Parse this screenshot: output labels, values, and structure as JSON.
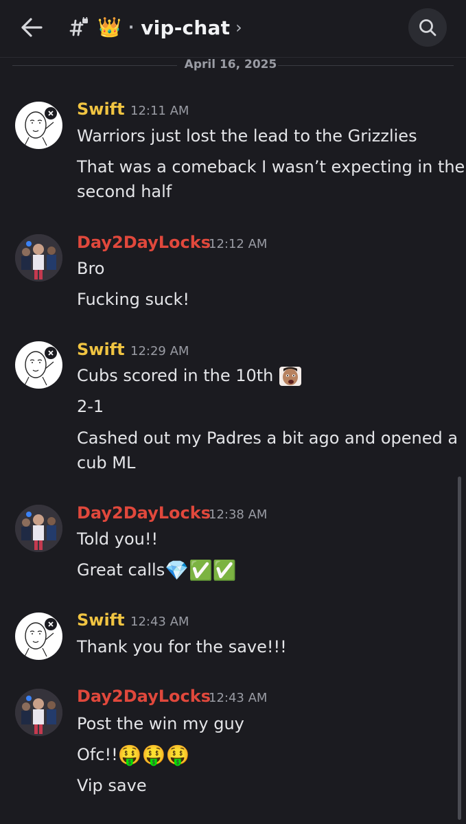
{
  "header": {
    "back_icon": "arrow-left-icon",
    "channel_icon": "hash-lock-icon",
    "channel_emoji": "👑",
    "separator": "·",
    "channel_name": "vip-chat",
    "chevron": "›",
    "search_icon": "search-icon"
  },
  "date_divider": "April 16, 2025",
  "colors": {
    "swift": "#f0c442",
    "d2d": "#e0483c",
    "background": "#1b1b20"
  },
  "messages": [
    {
      "user": "Swift",
      "time": "12:11 AM",
      "lines": [
        "Warriors just lost the lead to the Grizzlies",
        "That was a comeback I wasn’t expecting in the",
        "second half"
      ]
    },
    {
      "user": "Day2DayLocks",
      "time": "12:12 AM",
      "lines": [
        "Bro",
        "Fucking suck!"
      ]
    },
    {
      "user": "Swift",
      "time": "12:29 AM",
      "lines": [
        "Cubs scored in the 10th",
        "2-1",
        "Cashed out my Padres a bit ago and opened a",
        "cub ML"
      ]
    },
    {
      "user": "Day2DayLocks",
      "time": "12:38 AM",
      "lines": [
        "Told you!!",
        "Great calls",
        "💎✅✅"
      ]
    },
    {
      "user": "Swift",
      "time": "12:43 AM",
      "lines": [
        "Thank you for the save!!!"
      ]
    },
    {
      "user": "Day2DayLocks",
      "time": "12:43 AM",
      "lines": [
        "Post the win my guy",
        "Ofc!!",
        "🤑🤑🤑",
        "Vip save"
      ]
    }
  ]
}
